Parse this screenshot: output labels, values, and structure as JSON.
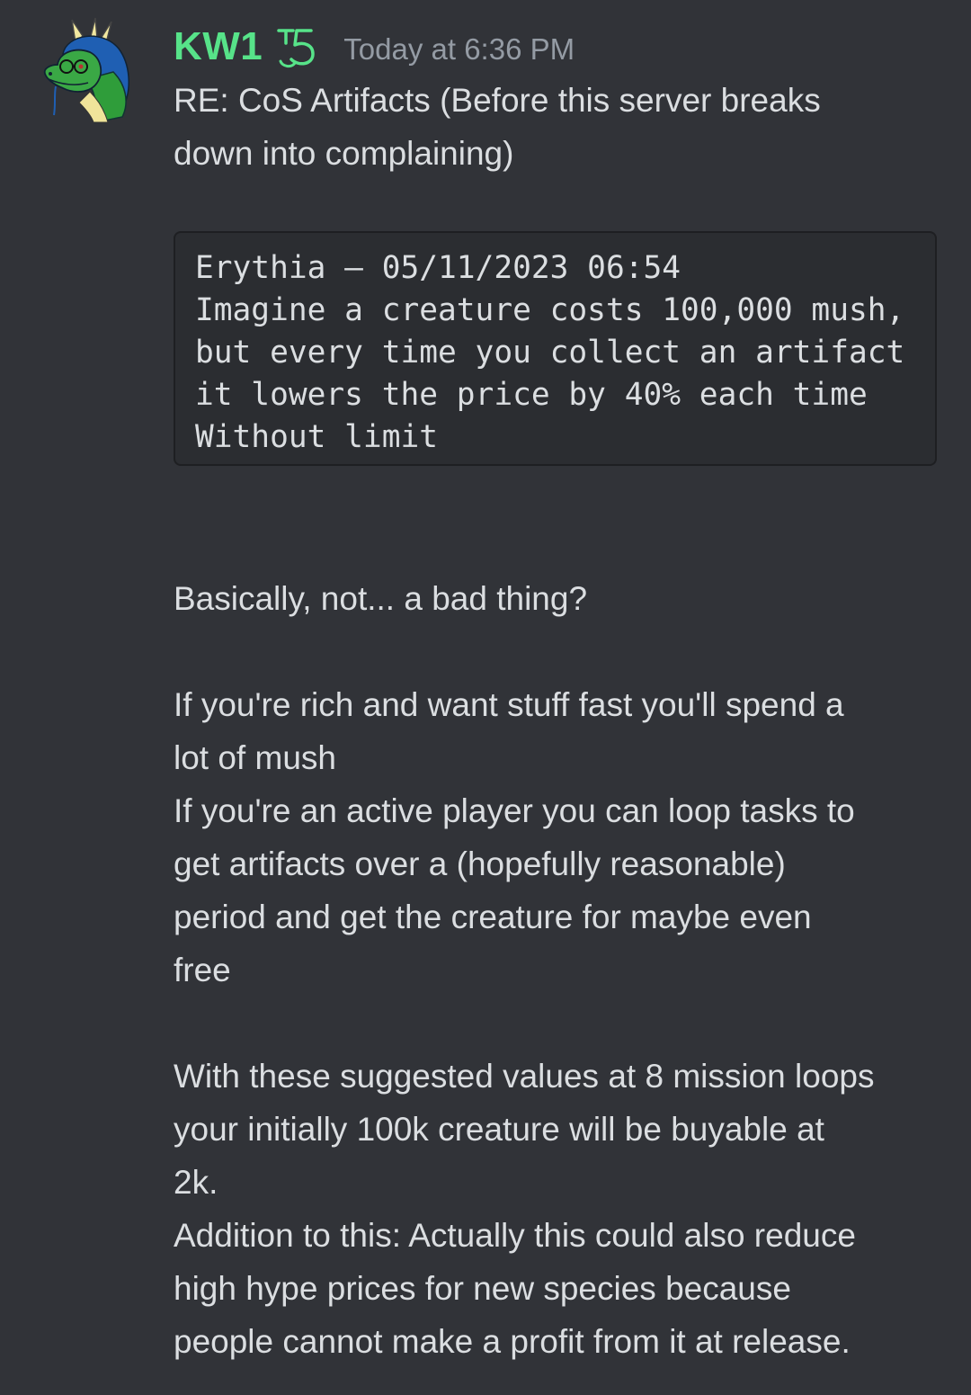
{
  "message": {
    "author": "KW1",
    "timestamp": "Today at 6:36 PM",
    "title_lines": [
      "RE: CoS Artifacts (Before this server breaks",
      "down into complaining)"
    ],
    "code_block_lines": [
      "Erythia — 05/11/2023 06:54",
      "Imagine a creature costs 100,000 mush,",
      "but every time you collect an artifact",
      "it lowers the price by 40% each time",
      "Without limit"
    ],
    "paragraphs": [
      [
        "Basically, not... a bad thing?"
      ],
      [
        "If you're rich and want stuff fast you'll spend a",
        "lot of mush",
        "If you're an active player you can loop tasks to",
        "get artifacts over a (hopefully reasonable)",
        "period and get the creature for maybe even",
        "free"
      ],
      [
        "With these suggested values at 8 mission loops",
        "your initially 100k creature will be buyable at",
        "2k.",
        "Addition to this: Actually this could also reduce",
        "high hype prices for new species because",
        "people cannot make a profit from it at release."
      ]
    ]
  },
  "icons": {
    "avatar": "dragon-avatar",
    "tag": "badge-icon"
  },
  "colors": {
    "background": "#313338",
    "username": "#57e389",
    "timestamp": "#949ba4",
    "text": "#dbdee1",
    "codeblock_bg": "#2b2d31"
  }
}
